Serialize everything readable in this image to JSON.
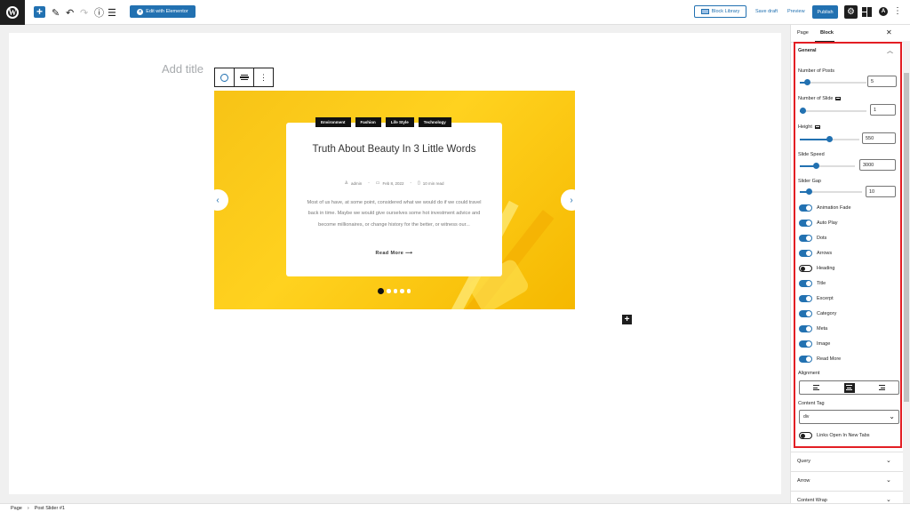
{
  "topbar": {
    "wp_logo": "W",
    "add_icon": "+",
    "edit_icon": "✎",
    "undo_icon": "↶",
    "redo_icon": "↷",
    "info_icon": "ⓘ",
    "list_icon": "☰",
    "elementor_label": "Edit with Elementor",
    "elementor_icon": "e",
    "block_library_label": "Block Library",
    "save_draft_label": "Save draft",
    "preview_label": "Preview",
    "publish_label": "Publish",
    "settings_icon": "⚙",
    "astra_icon": "A",
    "more_icon": "⋮"
  },
  "editor": {
    "title_placeholder": "Add title",
    "block_toolbar_more": "⋮",
    "inserter": "+"
  },
  "slide": {
    "categories": [
      "Environment",
      "Fashion",
      "Life Style",
      "Technology"
    ],
    "title": "Truth About Beauty In 3 Little Words",
    "author": "admin",
    "date": "Feb 8, 2022",
    "read_time": "10 min read",
    "excerpt": "Most of us have, at some point, considered what we would do if we could travel back in time. Maybe we would give ourselves some hot investment advice and become millionaires, or change history for the better, or witness our...",
    "read_more": "Read More",
    "read_more_arrow": "⟶",
    "prev_arrow": "‹",
    "next_arrow": "›",
    "dot_count": 5,
    "active_dot": 1,
    "author_icon": "♙",
    "date_icon": "▭",
    "time_icon": "▯",
    "sep1": "-",
    "sep2": "-"
  },
  "footer": {
    "crumb_root": "Page",
    "separator": "›",
    "crumb_current": "Post Slider #1"
  },
  "sidebar": {
    "tab_page": "Page",
    "tab_block": "Block",
    "close_icon": "✕",
    "general": {
      "title": "General",
      "chevron_up": "︿",
      "number_of_posts": {
        "label": "Number of Posts",
        "value": "5",
        "level": 0.07
      },
      "number_of_slide": {
        "label": "Number of Slide",
        "value": "1",
        "level": 0.0
      },
      "height": {
        "label": "Height",
        "value": "550",
        "level": 0.5
      },
      "slide_speed": {
        "label": "Slide Speed",
        "value": "3000",
        "level": 0.28
      },
      "slider_gap": {
        "label": "Slider Gap",
        "value": "10",
        "level": 0.11
      },
      "toggles": [
        {
          "label": "Animation Fade",
          "on": true
        },
        {
          "label": "Auto Play",
          "on": true
        },
        {
          "label": "Dots",
          "on": true
        },
        {
          "label": "Arrows",
          "on": true
        },
        {
          "label": "Heading",
          "on": false
        },
        {
          "label": "Title",
          "on": true
        },
        {
          "label": "Excerpt",
          "on": true
        },
        {
          "label": "Category",
          "on": true
        },
        {
          "label": "Meta",
          "on": true
        },
        {
          "label": "Image",
          "on": true
        },
        {
          "label": "Read More",
          "on": true
        }
      ],
      "alignment_label": "Alignment",
      "alignment_selected": "center",
      "content_tag_label": "Content Tag",
      "content_tag_value": "div",
      "select_chevron": "⌄",
      "links_new_tab": {
        "label": "Links Open In New Tabs",
        "on": false
      }
    },
    "collapsed": [
      {
        "label": "Query",
        "chevron": "⌄"
      },
      {
        "label": "Arrow",
        "chevron": "⌄"
      },
      {
        "label": "Content Wrap",
        "chevron": "⌄"
      }
    ]
  },
  "colors": {
    "accent": "#2271b1",
    "highlight": "#e31e24",
    "slide_bg": "#ffd21f"
  }
}
